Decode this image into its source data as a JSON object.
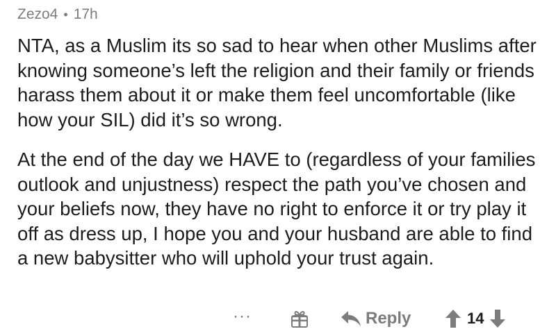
{
  "comment": {
    "author": "Zezo4",
    "separator": "•",
    "age": "17h",
    "paragraphs": [
      "NTA, as a Muslim its so sad to hear when other Muslims after knowing someone’s left the religion and their family or friends harass them about it or make them feel uncomfortable (like how your SIL) did it’s so wrong.",
      "At the end of the day we HAVE to (regardless of your families outlook and unjustness) respect the path you’ve chosen and your beliefs now, they have no right to enforce it or try play it off as dress up, I hope you and your husband are able to find a new babysitter who will uphold your trust again."
    ]
  },
  "actions": {
    "more_label": "···",
    "reply_label": "Reply",
    "score": "14",
    "icons": {
      "gift": "gift-icon",
      "reply": "reply-arrow-icon",
      "upvote": "upvote-arrow-icon",
      "downvote": "downvote-arrow-icon"
    },
    "icon_color": "#7c7c7c"
  }
}
